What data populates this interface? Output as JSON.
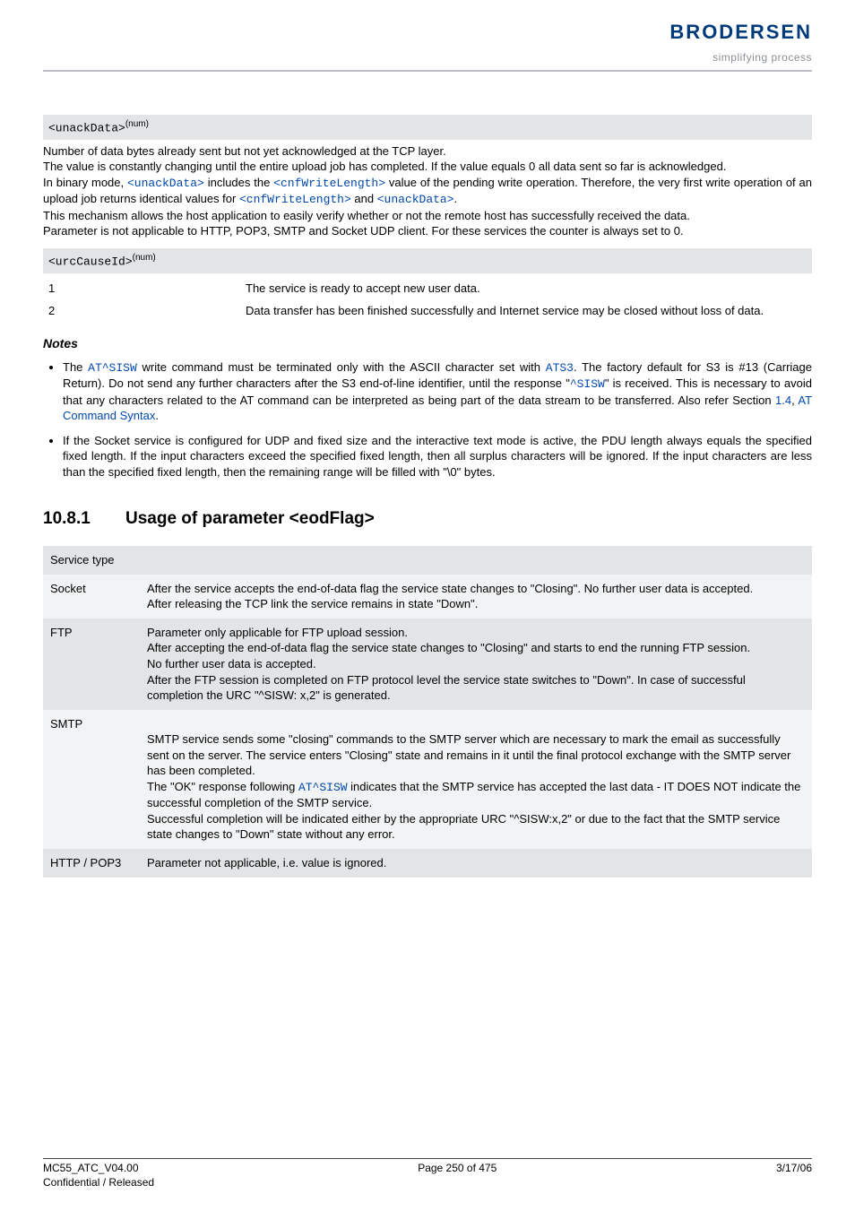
{
  "brand": {
    "name": "BRODERSEN",
    "tagline": "simplifying process"
  },
  "unackData": {
    "token": "<unackData>",
    "sup": "(num)",
    "p1": "Number of data bytes already sent but not yet acknowledged at the TCP layer.",
    "p2": "The value is constantly changing until the entire upload job has completed. If the value equals 0 all data sent so far is acknowledged.",
    "p3a": "In binary mode, ",
    "p3b": " includes the ",
    "p3c": " value of the pending write operation. Therefore, the very first write operation of an upload job returns identical values for ",
    "p3d": " and ",
    "p3e": ".",
    "tok_unack": "<unackData>",
    "tok_cnf": "<cnfWriteLength>",
    "p4": "This mechanism allows the host application to easily verify whether or not the remote host has successfully received the data.",
    "p5": "Parameter is not applicable to HTTP, POP3, SMTP and Socket UDP client. For these services the counter is always set to 0."
  },
  "urcCauseId": {
    "token": "<urcCauseId>",
    "sup": "(num)",
    "rows": [
      {
        "k": "1",
        "v": "The service is ready to accept new user data."
      },
      {
        "k": "2",
        "v": "Data transfer has been finished successfully and Internet service may be closed without loss of data."
      }
    ]
  },
  "notes": {
    "heading": "Notes",
    "n1": {
      "a": "The ",
      "at_sisw": "AT^SISW",
      "b": " write command must be terminated only with the ASCII character set with ",
      "ats3": "ATS3",
      "c": ". The factory default for S3 is #13 (Carriage Return). Do not send any further characters after the S3 end-of-line identifier, until the response \"",
      "sisw": "^SISW",
      "d": "\" is received. This is necessary to avoid that any characters related to the AT command can be interpreted as being part of the data stream to be transferred. Also refer Section ",
      "ref_num": "1.4",
      "ref_sep": ", ",
      "ref_label": "AT Command Syntax",
      "e": "."
    },
    "n2": "If the Socket service is configured for UDP and fixed size and the interactive text mode is active, the PDU length always equals the specified fixed length. If the input characters exceed the specified fixed length, then all surplus characters will be ignored. If the input characters are less than the specified fixed length, then the remaining range will be filled with \"\\0\" bytes."
  },
  "section": {
    "num": "10.8.1",
    "title": "Usage of parameter <eodFlag>"
  },
  "svc": {
    "header": "Service type",
    "rows": [
      {
        "name": "Socket",
        "desc": "After the service accepts the end-of-data flag the service state changes to \"Closing\". No further user data is accepted.\nAfter releasing the TCP link the service remains in state \"Down\"."
      },
      {
        "name": "FTP",
        "desc": "Parameter only applicable for FTP upload session.\nAfter accepting the end-of-data flag the service state changes to \"Closing\" and starts to end the running FTP session.\nNo further user data is accepted.\nAfter the FTP session is completed on FTP protocol level the service state switches to \"Down\". In case of successful completion the URC \"^SISW: x,2\" is generated."
      },
      {
        "name": "SMTP",
        "desc_a": "SMTP service sends some \"closing\" commands to the SMTP server which are necessary to mark the email as successfully sent on the server. The service enters \"Closing\" state and remains in it until the final protocol exchange with the SMTP server has been completed.\nThe \"OK\" response following ",
        "tok": "AT^SISW",
        "desc_b": " indicates that the SMTP service has accepted the last data - IT DOES NOT indicate the successful completion of the SMTP service.\nSuccessful completion will be indicated either by the appropriate URC \"^SISW:x,2\" or due to the fact that the SMTP service state changes to \"Down\" state without any error."
      },
      {
        "name": "HTTP / POP3",
        "desc": "Parameter not applicable, i.e. value is ignored."
      }
    ]
  },
  "footer": {
    "left1": "MC55_ATC_V04.00",
    "center": "Page 250 of 475",
    "right": "3/17/06",
    "left2": "Confidential / Released"
  }
}
